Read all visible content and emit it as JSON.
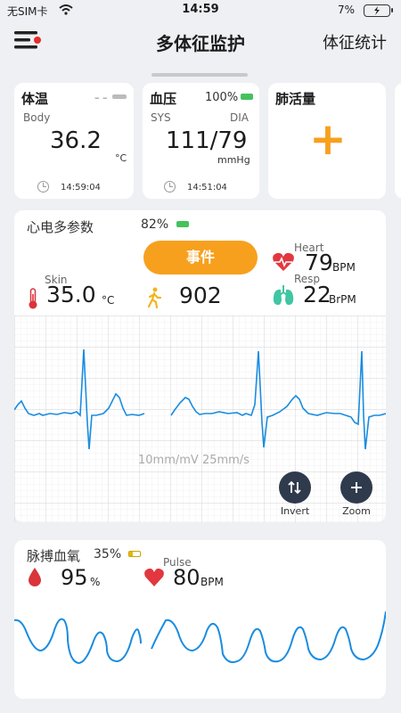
{
  "status_bar": {
    "carrier": "无SIM卡",
    "time": "14:59",
    "battery_pct": "7%"
  },
  "nav": {
    "title": "多体征监护",
    "right_label": "体征统计"
  },
  "temp_card": {
    "title": "体温",
    "dash": "– –",
    "sub": "Body",
    "value": "36.2",
    "unit": "°C",
    "time": "14:59:04"
  },
  "bp_card": {
    "title": "血压",
    "battery": "100%",
    "sys_label": "SYS",
    "dia_label": "DIA",
    "value": "111/79",
    "unit": "mmHg",
    "time": "14:51:04"
  },
  "lung_card": {
    "title": "肺活量",
    "add": "+"
  },
  "ecg_card": {
    "title": "心电多参数",
    "battery": "82%",
    "event_button": "事件",
    "skin_label": "Skin",
    "skin_value": "35.0",
    "skin_unit": "°C",
    "steps_value": "902",
    "heart_label": "Heart",
    "heart_value": "79",
    "heart_unit": "BPM",
    "resp_label": "Resp",
    "resp_value": "22",
    "resp_unit": "BrPM",
    "scale_text": "10mm/mV 25mm/s",
    "invert_label": "Invert",
    "zoom_label": "Zoom"
  },
  "spo2_card": {
    "title": "脉搏血氧",
    "battery": "35%",
    "spo2_value": "95",
    "spo2_unit": "%",
    "pulse_label": "Pulse",
    "pulse_value": "80",
    "pulse_unit": "BPM"
  },
  "colors": {
    "accent": "#f7a01e",
    "wave": "#1a8ce0",
    "heart": "#e2373f",
    "lung": "#3fc6a2",
    "thermo": "#d9343a"
  }
}
